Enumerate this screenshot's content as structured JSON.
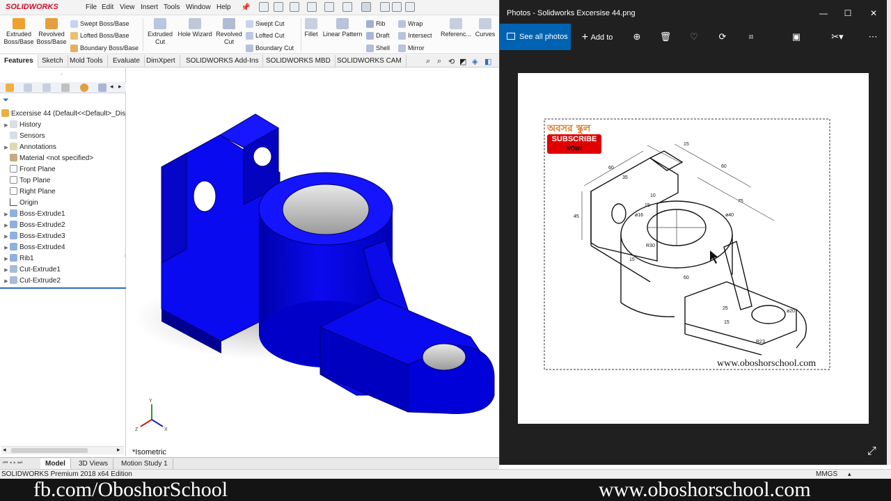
{
  "solidworks": {
    "logo": "SOLIDWORKS",
    "menu": [
      "File",
      "Edit",
      "View",
      "Insert",
      "Tools",
      "Window",
      "Help"
    ],
    "ribbon": {
      "extruded_boss": "Extruded Boss/Base",
      "revolved_boss": "Revolved Boss/Base",
      "swept_boss": "Swept Boss/Base",
      "lofted_boss": "Lofted Boss/Base",
      "boundary_boss": "Boundary Boss/Base",
      "extruded_cut": "Extruded Cut",
      "hole_wizard": "Hole Wizard",
      "revolved_cut": "Revolved Cut",
      "swept_cut": "Swept Cut",
      "lofted_cut": "Lofted Cut",
      "boundary_cut": "Boundary Cut",
      "fillet": "Fillet",
      "linear_pattern": "Linear Pattern",
      "rib": "Rib",
      "draft": "Draft",
      "shell": "Shell",
      "wrap": "Wrap",
      "intersect": "Intersect",
      "mirror": "Mirror",
      "reference": "Referenc...",
      "curves": "Curves"
    },
    "tabs": [
      "Features",
      "Sketch",
      "Mold Tools",
      "Evaluate",
      "DimXpert",
      "SOLIDWORKS Add-Ins",
      "SOLIDWORKS MBD",
      "SOLIDWORKS CAM"
    ],
    "active_tab": "Features",
    "tree": {
      "root": "Excersise 44  (Default<<Default>_Dis",
      "items": [
        {
          "label": "History",
          "expandable": true
        },
        {
          "label": "Sensors",
          "expandable": false
        },
        {
          "label": "Annotations",
          "expandable": true
        },
        {
          "label": "Material <not specified>",
          "expandable": false
        },
        {
          "label": "Front Plane",
          "expandable": false
        },
        {
          "label": "Top Plane",
          "expandable": false
        },
        {
          "label": "Right Plane",
          "expandable": false
        },
        {
          "label": "Origin",
          "expandable": false
        },
        {
          "label": "Boss-Extrude1",
          "expandable": true
        },
        {
          "label": "Boss-Extrude2",
          "expandable": true
        },
        {
          "label": "Boss-Extrude3",
          "expandable": true
        },
        {
          "label": "Boss-Extrude4",
          "expandable": true
        },
        {
          "label": "Rib1",
          "expandable": true
        },
        {
          "label": "Cut-Extrude1",
          "expandable": true
        },
        {
          "label": "Cut-Extrude2",
          "expandable": true
        }
      ]
    },
    "view_label": "*Isometric",
    "bottom_tabs": [
      "Model",
      "3D Views",
      "Motion Study 1"
    ],
    "active_bottom_tab": "Model",
    "status": "SOLIDWORKS Premium 2018 x64 Edition",
    "units": "MMGS",
    "model_color": "#0b0bf0"
  },
  "photos": {
    "title": "Photos - Solidworks Excersise 44.png",
    "see_all": "See all photos",
    "add_to": "Add to",
    "drawing": {
      "brand_bengali": "অবসর স্কুল",
      "subscribe": "SUBSCRIBE",
      "now": "NOW!",
      "website": "www.oboshorschool.com",
      "dims": [
        "15",
        "60",
        "35",
        "60",
        "75",
        "45",
        "15",
        "10",
        "ø16",
        "ø40",
        "R30",
        "15",
        "60",
        "25",
        "15",
        "ø20",
        "R23"
      ]
    }
  },
  "caption": {
    "left": "fb.com/OboshorSchool",
    "right": "www.oboshorschool.com"
  }
}
